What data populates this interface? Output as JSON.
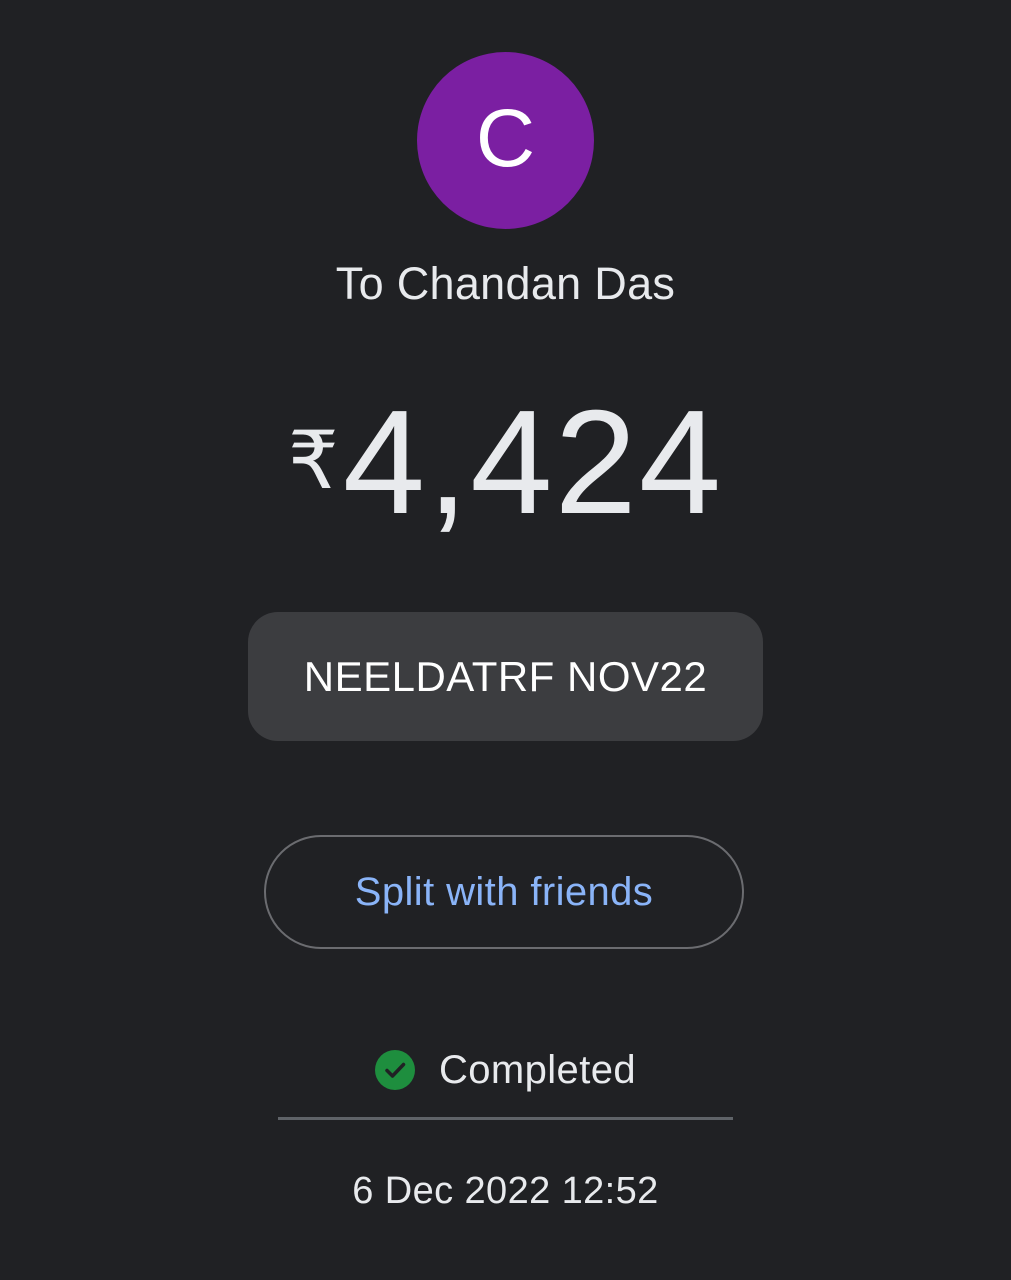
{
  "recipient": {
    "avatar_letter": "C",
    "avatar_color": "#7b1fa2",
    "label": "To Chandan Das"
  },
  "payment": {
    "currency_symbol": "₹",
    "amount": "4,424",
    "note": "NEELDATRF NOV22"
  },
  "actions": {
    "split_label": "Split with friends"
  },
  "status": {
    "icon": "check-circle-icon",
    "icon_color": "#1e8e3e",
    "text": "Completed"
  },
  "timestamp": "6 Dec 2022 12:52",
  "colors": {
    "background": "#202124",
    "accent": "#8ab4f8",
    "note_background": "#3c3d40"
  }
}
